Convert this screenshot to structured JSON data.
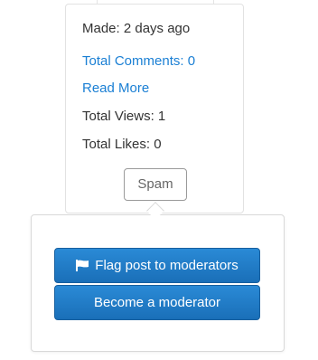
{
  "card": {
    "made": "Made: 2 days ago",
    "total_comments": "Total Comments: 0",
    "read_more": "Read More",
    "total_views": "Total Views: 1",
    "total_likes": "Total Likes: 0",
    "spam_label": "Spam"
  },
  "popover": {
    "flag_label": "Flag post to moderators",
    "flag_icon": "flag-icon",
    "moderator_label": "Become a moderator"
  },
  "colors": {
    "link": "#1a7fd4",
    "primary_button": "#1f78c6",
    "text": "#333333"
  }
}
